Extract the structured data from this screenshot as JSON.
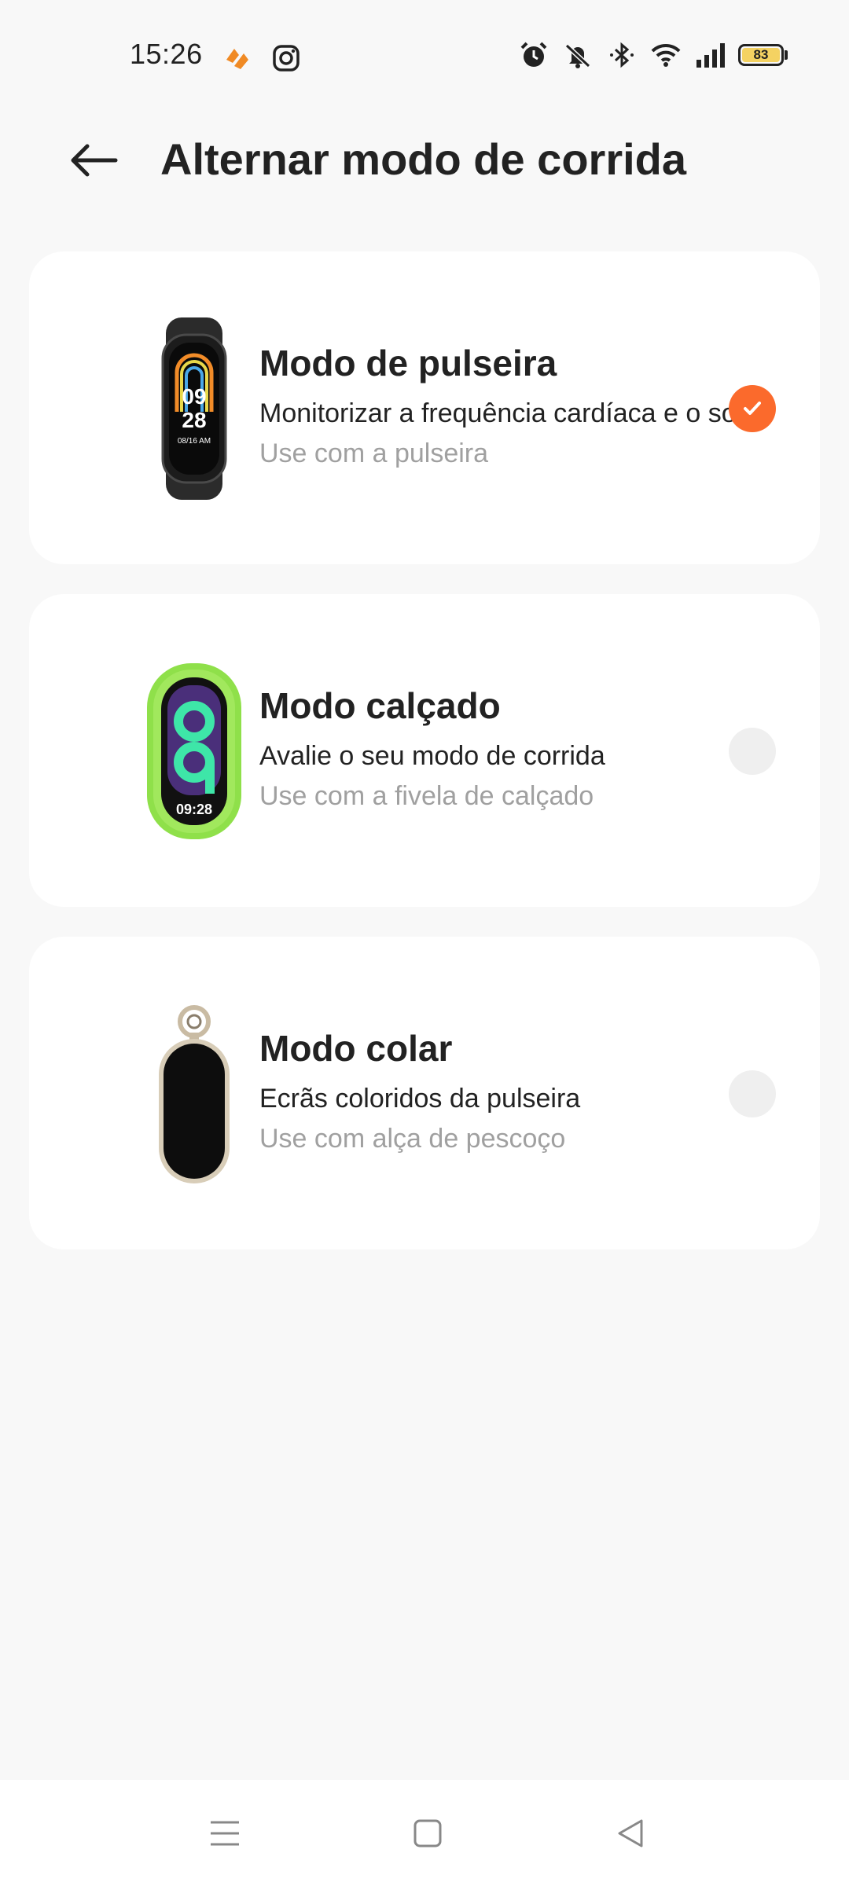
{
  "status_bar": {
    "time": "15:26",
    "left_icons": [
      "strava-like-app-icon",
      "instagram-icon"
    ],
    "right_icons": [
      "alarm-icon",
      "mute-icon",
      "bluetooth-icon",
      "wifi-icon",
      "signal-icon"
    ],
    "battery": "83"
  },
  "header": {
    "title": "Alternar modo de corrida"
  },
  "modes": [
    {
      "title": "Modo de pulseira",
      "description": "Monitorizar a frequência cardíaca e o sono",
      "subtitle": "Use com a pulseira",
      "selected": true
    },
    {
      "title": "Modo calçado",
      "description": "Avalie o seu modo de corrida",
      "subtitle": "Use com a fivela de calçado",
      "selected": false
    },
    {
      "title": "Modo colar",
      "description": "Ecrãs coloridos da pulseira",
      "subtitle": "Use com alça de pescoço",
      "selected": false
    }
  ],
  "band_face": {
    "hour": "09",
    "minute": "28",
    "date": "08/16 AM",
    "shoe_time": "09:28"
  },
  "colors": {
    "accent": "#fb6a2c",
    "background": "#f8f8f8",
    "card": "#ffffff",
    "battery_fill": "#f4d262",
    "shoe_case": "#8fe04a"
  },
  "nav": {
    "buttons": [
      "menu-icon",
      "home-icon",
      "back-triangle-icon"
    ]
  }
}
